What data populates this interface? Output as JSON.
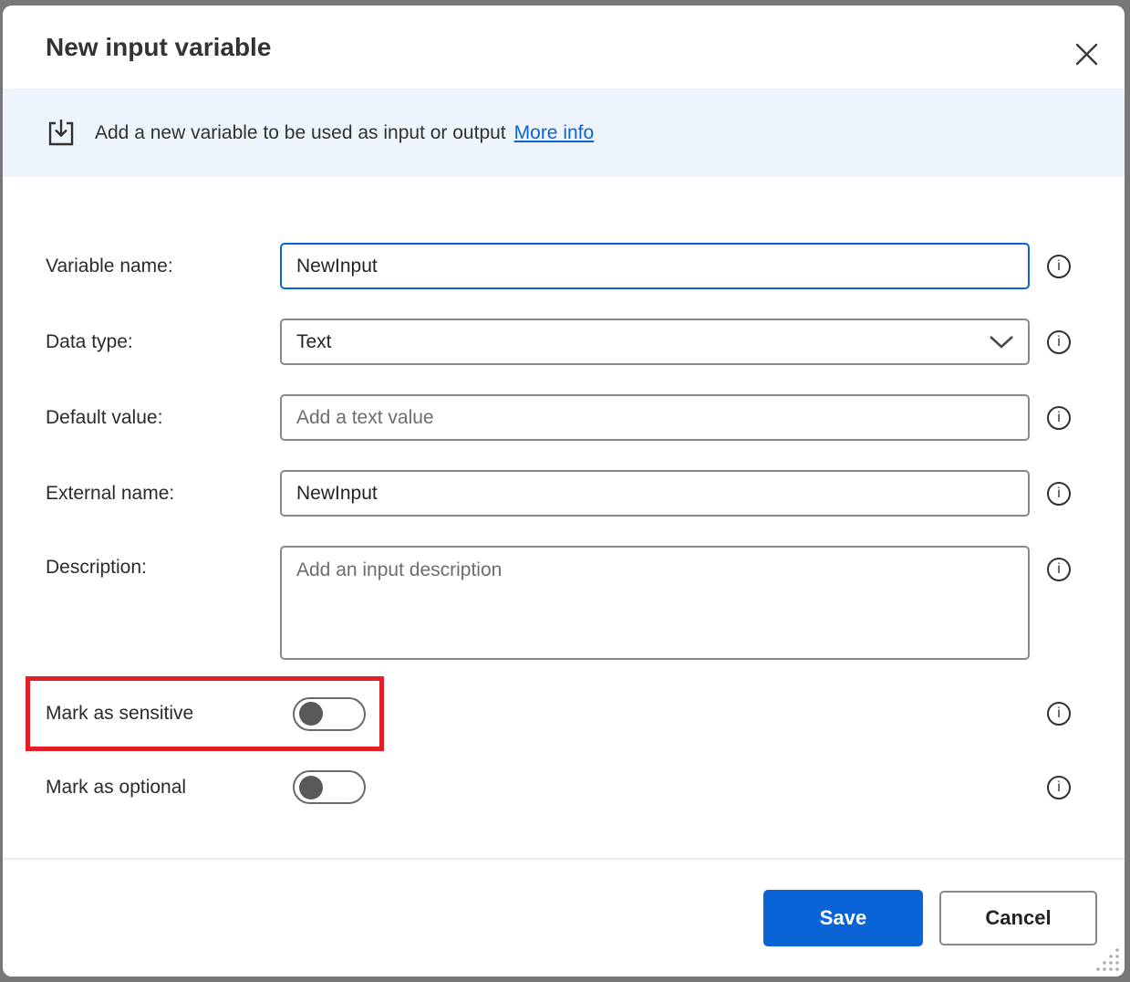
{
  "dialog": {
    "title": "New input variable"
  },
  "banner": {
    "icon": "input-variable-icon",
    "message": "Add a new variable to be used as input or output",
    "link_label": "More info"
  },
  "form": {
    "fields": [
      {
        "label": "Variable name:",
        "control": "text",
        "value": "NewInput",
        "placeholder": "",
        "focused": true
      },
      {
        "label": "Data type:",
        "control": "select",
        "value": "Text"
      },
      {
        "label": "Default value:",
        "control": "text",
        "value": "",
        "placeholder": "Add a text value"
      },
      {
        "label": "External name:",
        "control": "text",
        "value": "NewInput",
        "placeholder": ""
      },
      {
        "label": "Description:",
        "control": "textarea",
        "value": "",
        "placeholder": "Add an input description"
      }
    ],
    "toggles": [
      {
        "label": "Mark as sensitive",
        "state": "off",
        "highlighted": true
      },
      {
        "label": "Mark as optional",
        "state": "off"
      }
    ]
  },
  "footer": {
    "save_label": "Save",
    "cancel_label": "Cancel"
  },
  "icons": {
    "info_glyph": "i"
  },
  "colors": {
    "accent_blue": "#0b64d6",
    "highlight_red": "#e41e26",
    "banner_bg": "#eef4fb",
    "input_border_gray": "#8a8886",
    "toggle_gray": "#595959",
    "frame_gray": "#787878"
  }
}
